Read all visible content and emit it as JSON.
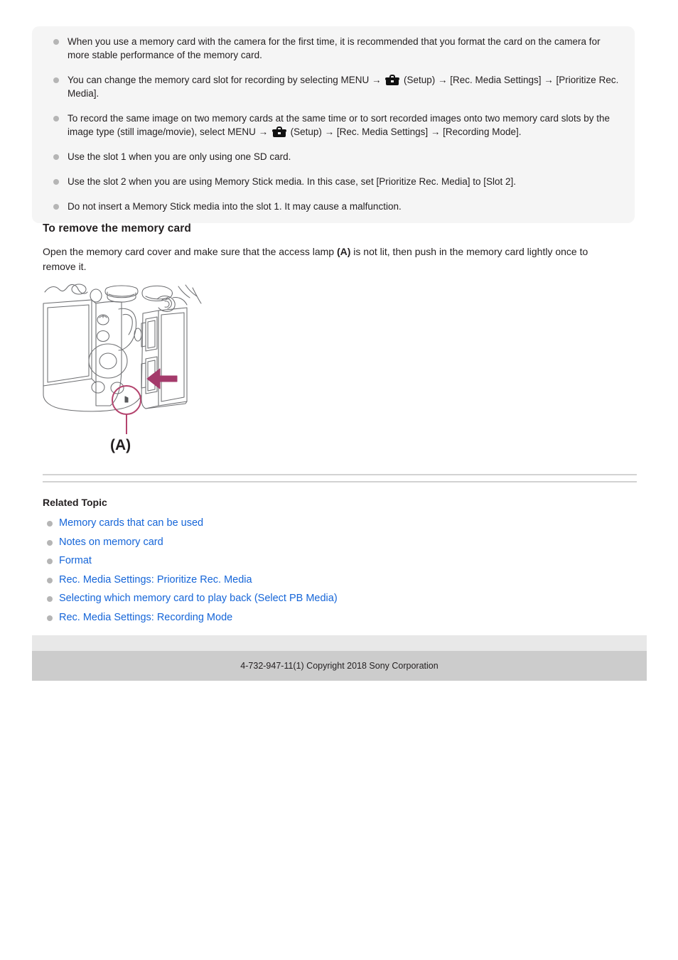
{
  "note_box": {
    "items": [
      {
        "id": "note-format-card",
        "segments": [
          {
            "type": "text",
            "value": "When you use a memory card with the camera for the first time, it is recommended that you format the card on the camera for more stable performance of the memory card."
          }
        ]
      },
      {
        "id": "note-change-slot",
        "segments": [
          {
            "type": "text",
            "value": "You can change the memory card slot for recording by selecting MENU → "
          },
          {
            "type": "icon",
            "value": "setup-toolbox-icon"
          },
          {
            "type": "text",
            "value": " (Setup) → [Rec. Media Settings] → [Prioritize Rec. Media]."
          }
        ]
      },
      {
        "id": "note-record-two-cards",
        "segments": [
          {
            "type": "text",
            "value": "To record the same image on two memory cards at the same time or to sort recorded images onto two memory card slots by the image type (still image/movie), select MENU → "
          },
          {
            "type": "icon",
            "value": "setup-toolbox-icon"
          },
          {
            "type": "text",
            "value": " (Setup) → [Rec. Media Settings] → [Recording Mode]."
          }
        ]
      },
      {
        "id": "note-slot-1-sd",
        "segments": [
          {
            "type": "text",
            "value": "Use the slot 1 when you are only using one SD card."
          }
        ]
      },
      {
        "id": "note-slot-2-ms",
        "segments": [
          {
            "type": "text",
            "value": "Use the slot 2 when you are using Memory Stick media. In this case, set [Prioritize Rec. Media] to [Slot 2]."
          }
        ]
      },
      {
        "id": "note-no-ms-slot-1",
        "segments": [
          {
            "type": "text",
            "value": "Do not insert a Memory Stick media into the slot 1. It may cause a malfunction."
          }
        ]
      }
    ]
  },
  "section": {
    "heading": "To remove the memory card",
    "paragraph_before": "Open the memory card cover and make sure that the access lamp ",
    "paragraph_bold": "(A)",
    "paragraph_after": " is not lit, then push in the memory card lightly once to remove it."
  },
  "illustration": {
    "name": "camera-memory-card-slot-diagram",
    "callout_label": "(A)",
    "callout_color": "#b4446e",
    "arrow_color": "#a43a6b",
    "line_color": "#6d6e71"
  },
  "related": {
    "heading": "Related Topic",
    "links": [
      "Memory cards that can be used",
      "Notes on memory card",
      "Format",
      "Rec. Media Settings: Prioritize Rec. Media",
      "Selecting which memory card to play back (Select PB Media)",
      "Rec. Media Settings: Recording Mode"
    ],
    "link_color": "#1565d8"
  },
  "footer": {
    "copyright": "4-732-947-11(1) Copyright 2018 Sony Corporation",
    "top_band_color": "#e8e8e8",
    "bar_color": "#cccccc"
  }
}
